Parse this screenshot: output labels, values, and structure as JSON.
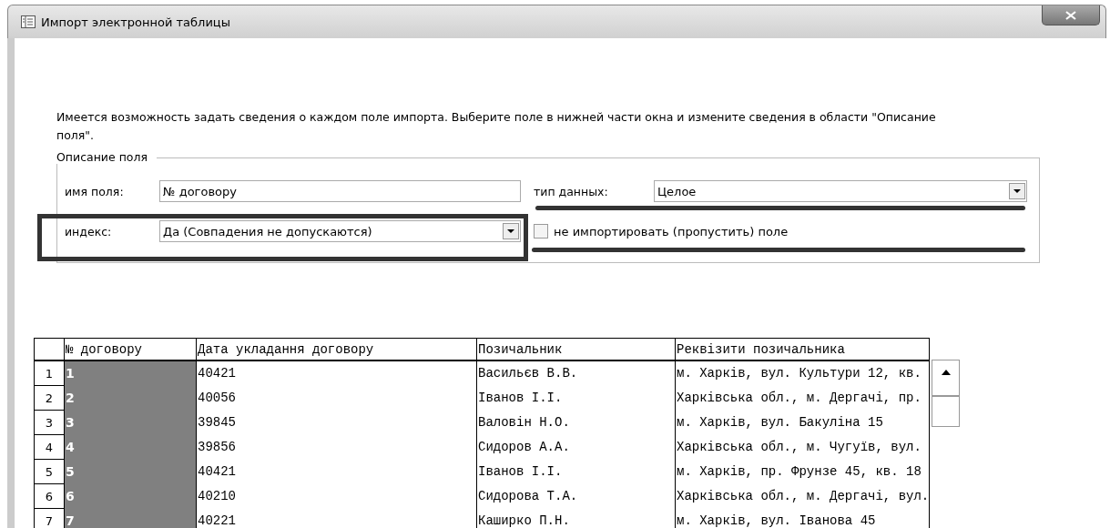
{
  "window": {
    "title": "Импорт электронной таблицы"
  },
  "intro": "Имеется возможность задать сведения о каждом поле импорта. Выберите поле в нижней части окна и измените сведения в области \"Описание поля\".",
  "field_options": {
    "legend": "Описание поля",
    "field_name": {
      "label": "имя поля:",
      "value": "№ договору"
    },
    "data_type": {
      "label": "тип данных:",
      "value": "Целое"
    },
    "index": {
      "label": "индекс:",
      "value": "Да (Совпадения не допускаются)"
    },
    "skip": {
      "label": "не импортировать (пропустить) поле",
      "checked": false
    }
  },
  "table": {
    "columns": [
      {
        "label": "№ договору",
        "selected": true
      },
      {
        "label": "Дата укладання договору",
        "selected": false
      },
      {
        "label": "Позичальник",
        "selected": false
      },
      {
        "label": "Реквізити позичальника",
        "selected": false
      }
    ],
    "rows": [
      {
        "number": "1",
        "cells": [
          "1",
          "40421",
          "Васильєв В.В.",
          "м. Харків, вул. Культури 12, кв."
        ]
      },
      {
        "number": "2",
        "cells": [
          "2",
          "40056",
          "Іванов І.І.",
          "Харківська обл., м. Дергачі, пр."
        ]
      },
      {
        "number": "3",
        "cells": [
          "3",
          "39845",
          "Валовін Н.О.",
          "м. Харків, вул. Бакуліна 15"
        ]
      },
      {
        "number": "4",
        "cells": [
          "4",
          "39856",
          "Сидоров А.А.",
          "Харківська обл., м. Чугуїв, вул."
        ]
      },
      {
        "number": "5",
        "cells": [
          "5",
          "40421",
          "Іванов І.І.",
          "м. Харків, пр. Фрунзе 45, кв. 18"
        ]
      },
      {
        "number": "6",
        "cells": [
          "6",
          "40210",
          "Сидорова Т.А.",
          "Харківська обл., м. Дергачі, вул."
        ]
      },
      {
        "number": "7",
        "cells": [
          "7",
          "40221",
          "Каширко П.Н.",
          "м. Харків, вул. Іванова 45"
        ]
      }
    ]
  }
}
